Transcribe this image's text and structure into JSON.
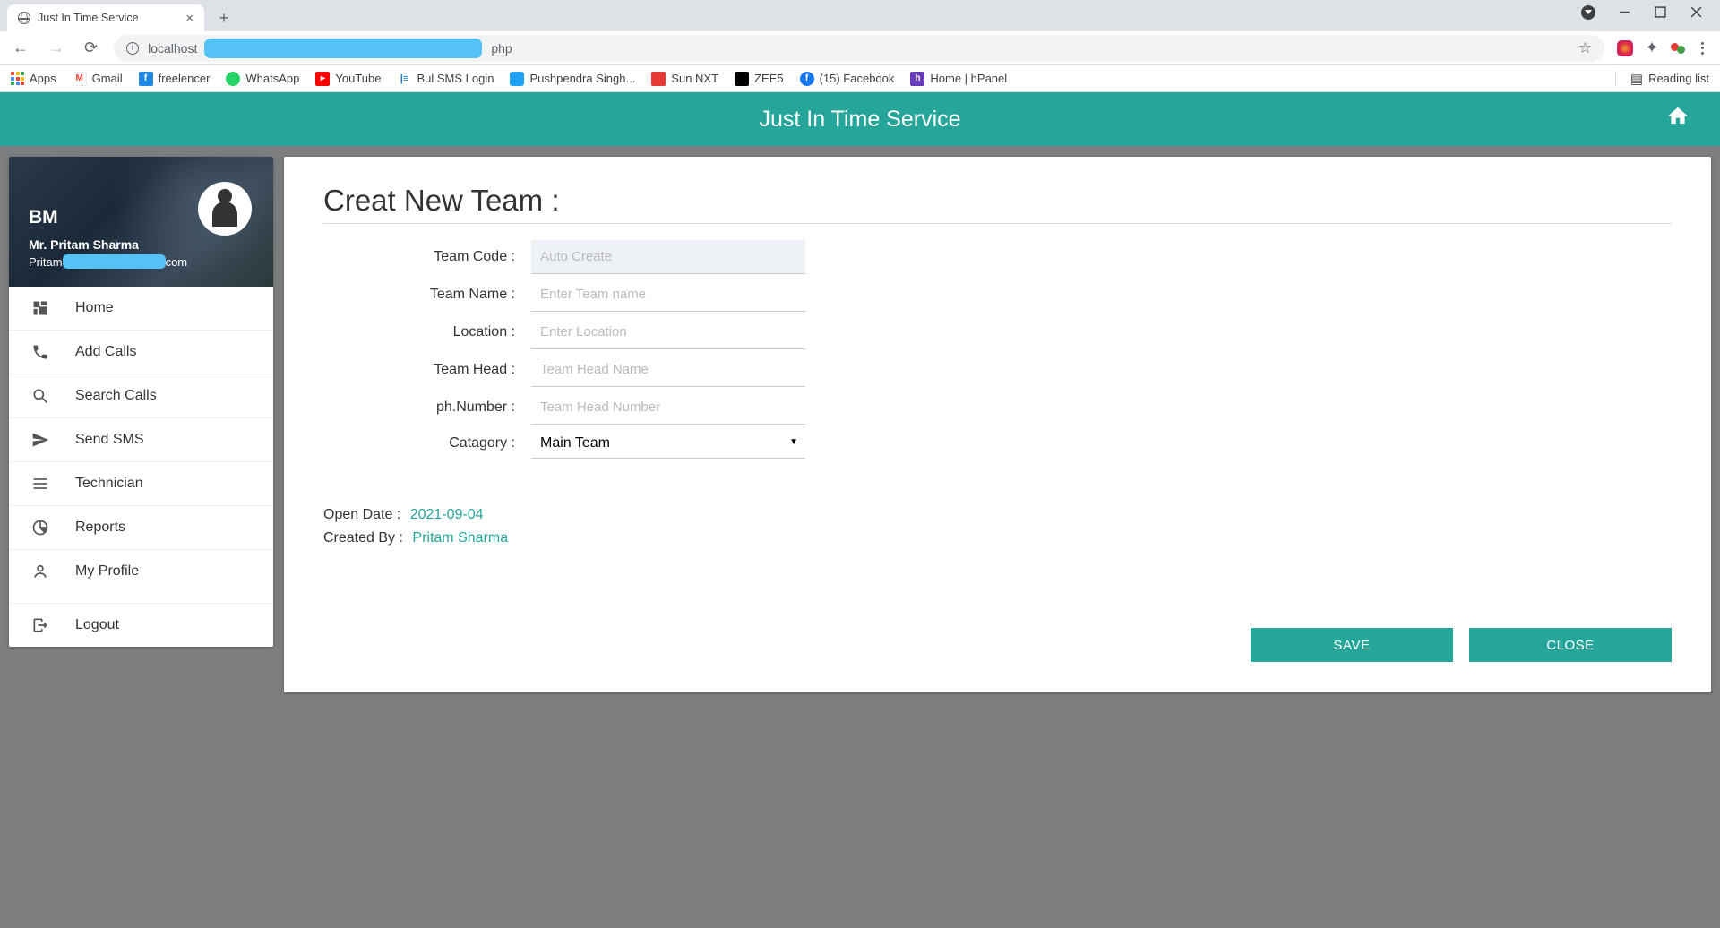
{
  "browser": {
    "tab_title": "Just In Time Service",
    "url_prefix": "localhost",
    "url_suffix": "php",
    "bookmarks": {
      "apps": "Apps",
      "gmail": "Gmail",
      "freelencer": "freelencer",
      "whatsapp": "WhatsApp",
      "youtube": "YouTube",
      "bulsms": "Bul SMS Login",
      "pushpendra": "Pushpendra Singh...",
      "sunnxt": "Sun NXT",
      "zee5": "ZEE5",
      "facebook": "(15) Facebook",
      "hpanel": "Home | hPanel",
      "reading_list": "Reading list"
    }
  },
  "app": {
    "header_title": "Just In Time Service"
  },
  "sidebar": {
    "role": "BM",
    "user_name": "Mr. Pritam Sharma",
    "email_prefix": "Pritam",
    "email_suffix": "com",
    "items": {
      "home": "Home",
      "add_calls": "Add Calls",
      "search_calls": "Search Calls",
      "send_sms": "Send SMS",
      "technician": "Technician",
      "reports": "Reports",
      "my_profile": "My Profile",
      "logout": "Logout"
    }
  },
  "form": {
    "heading": "Creat New Team :",
    "labels": {
      "team_code": "Team Code :",
      "team_name": "Team Name :",
      "location": "Location :",
      "team_head": "Team Head :",
      "phone": "ph.Number :",
      "category": "Catagory :"
    },
    "placeholders": {
      "team_code": "Auto Create",
      "team_name": "Enter Team name",
      "location": "Enter Location",
      "team_head": "Team Head Name",
      "phone": "Team Head Number"
    },
    "category_selected": "Main Team",
    "meta": {
      "open_date_label": "Open Date :",
      "open_date_value": "2021-09-04",
      "created_by_label": "Created By :",
      "created_by_value": "Pritam Sharma"
    },
    "buttons": {
      "save": "SAVE",
      "close": "CLOSE"
    }
  }
}
